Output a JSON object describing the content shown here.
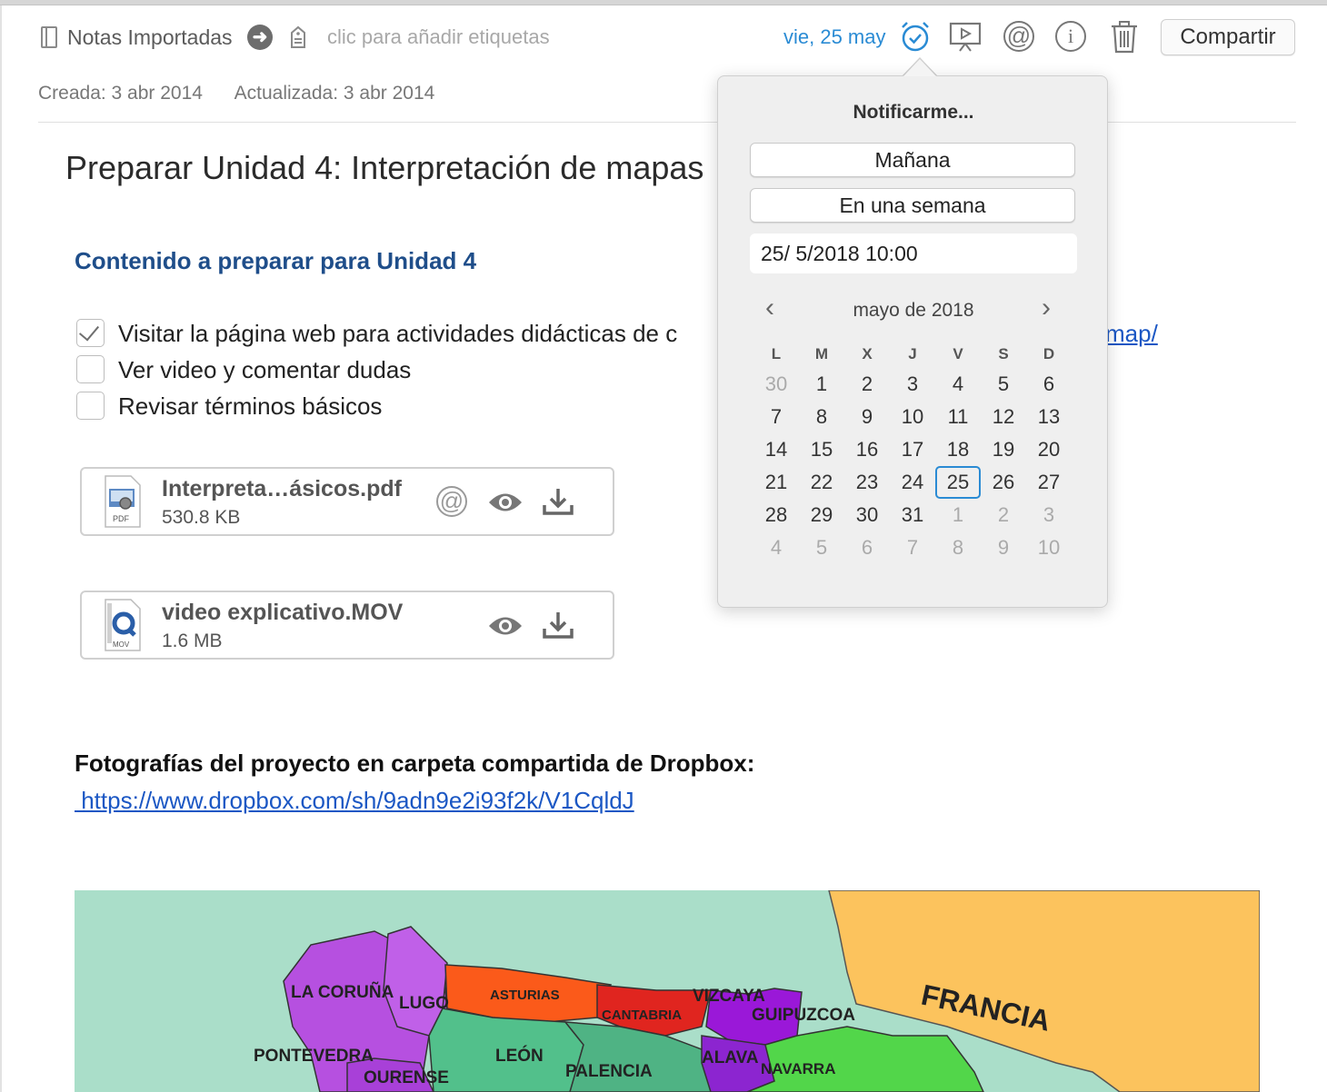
{
  "header": {
    "notebook": "Notas Importadas",
    "tag_placeholder": "clic para añadir etiquetas",
    "reminder_date": "vie, 25 may",
    "share_label": "Compartir"
  },
  "meta": {
    "created": "Creada: 3 abr 2014",
    "updated": "Actualizada: 3 abr 2014"
  },
  "note": {
    "title": "Preparar Unidad 4: Interpretación de mapas",
    "subtitle": "Contenido a preparar para Unidad 4",
    "todos": [
      {
        "label": "Visitar la página web para actividades didácticas de c",
        "checked": true
      },
      {
        "label": "Ver video y comentar dudas",
        "checked": false
      },
      {
        "label": "Revisar términos básicos",
        "checked": false
      }
    ],
    "link_tail": "map/",
    "attachments": [
      {
        "name": "Interpreta…ásicos.pdf",
        "size": "530.8 KB",
        "type": "PDF"
      },
      {
        "name": "video explicativo.MOV",
        "size": "1.6 MB",
        "type": "MOV"
      }
    ],
    "photos_heading": "Fotografías del proyecto en carpeta compartida de Dropbox:",
    "photos_link": " https://www.dropbox.com/sh/9adn9e2i93f2k/V1CqldJ"
  },
  "map": {
    "labels": [
      "LA CORUÑA",
      "LUGO",
      "ASTURIAS",
      "CANTABRIA",
      "VIZCAYA",
      "GUIPUZCOA",
      "FRANCIA",
      "PONTEVEDRA",
      "LEÓN",
      "PALENCIA",
      "ALAVA",
      "NAVARRA",
      "OURENSE"
    ]
  },
  "popover": {
    "title": "Notificarme...",
    "tomorrow": "Mañana",
    "week": "En una semana",
    "datetime": "25/  5/2018 10:00",
    "month": "mayo de 2018",
    "weekdays": [
      "L",
      "M",
      "X",
      "J",
      "V",
      "S",
      "D"
    ],
    "weeks": [
      [
        "30",
        "1",
        "2",
        "3",
        "4",
        "5",
        "6"
      ],
      [
        "7",
        "8",
        "9",
        "10",
        "11",
        "12",
        "13"
      ],
      [
        "14",
        "15",
        "16",
        "17",
        "18",
        "19",
        "20"
      ],
      [
        "21",
        "22",
        "23",
        "24",
        "25",
        "26",
        "27"
      ],
      [
        "28",
        "29",
        "30",
        "31",
        "1",
        "2",
        "3"
      ],
      [
        "4",
        "5",
        "6",
        "7",
        "8",
        "9",
        "10"
      ]
    ],
    "selected_day": "25"
  },
  "colors": {
    "accent": "#2a8bd4",
    "link": "#1b57c4",
    "subtitle": "#1f4e8a"
  }
}
